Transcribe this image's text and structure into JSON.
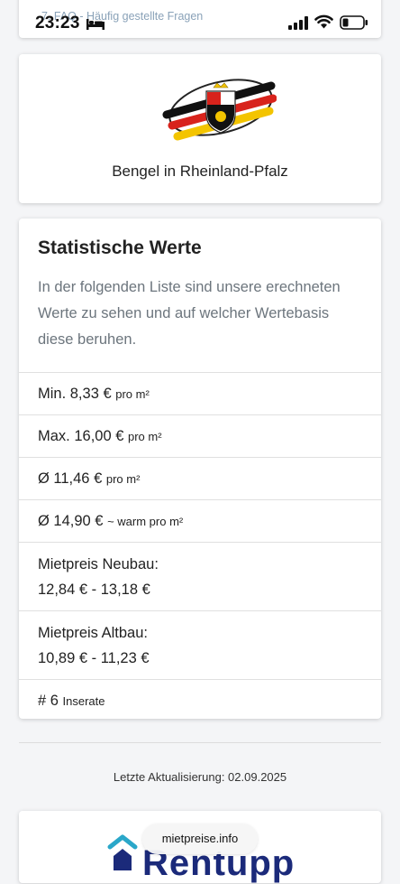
{
  "status_bar": {
    "time": "23:23"
  },
  "prev_card": {
    "link_text": "7. FAQ - Häufig gestellte Fragen"
  },
  "region": {
    "name": "Bengel in Rheinland-Pfalz"
  },
  "stats": {
    "title": "Statistische Werte",
    "description": "In der folgenden Liste sind unsere erechneten Werte zu sehen und auf welcher Wertebasis diese beruhen.",
    "rows": [
      {
        "main": "Min. 8,33 €",
        "sub": "pro m²"
      },
      {
        "main": "Max. 16,00 €",
        "sub": "pro m²"
      },
      {
        "main": "Ø 11,46 €",
        "sub": "pro m²"
      },
      {
        "main": "Ø 14,90 €",
        "sub": "~ warm pro m²"
      },
      {
        "label": "Mietpreis Neubau:",
        "value": "12,84 € - 13,18 €"
      },
      {
        "label": "Mietpreis Altbau:",
        "value": "10,89 € - 11,23 €"
      },
      {
        "main": "# 6",
        "sub": "Inserate"
      }
    ]
  },
  "footer": {
    "update_text": "Letzte Aktualisierung: 02.09.2025",
    "brand": "Rentupp",
    "url": "mietpreise.info"
  },
  "colors": {
    "brand": "#1b2a7a",
    "brand_icon": "#2aa7c9",
    "muted_text": "#6c757d"
  }
}
